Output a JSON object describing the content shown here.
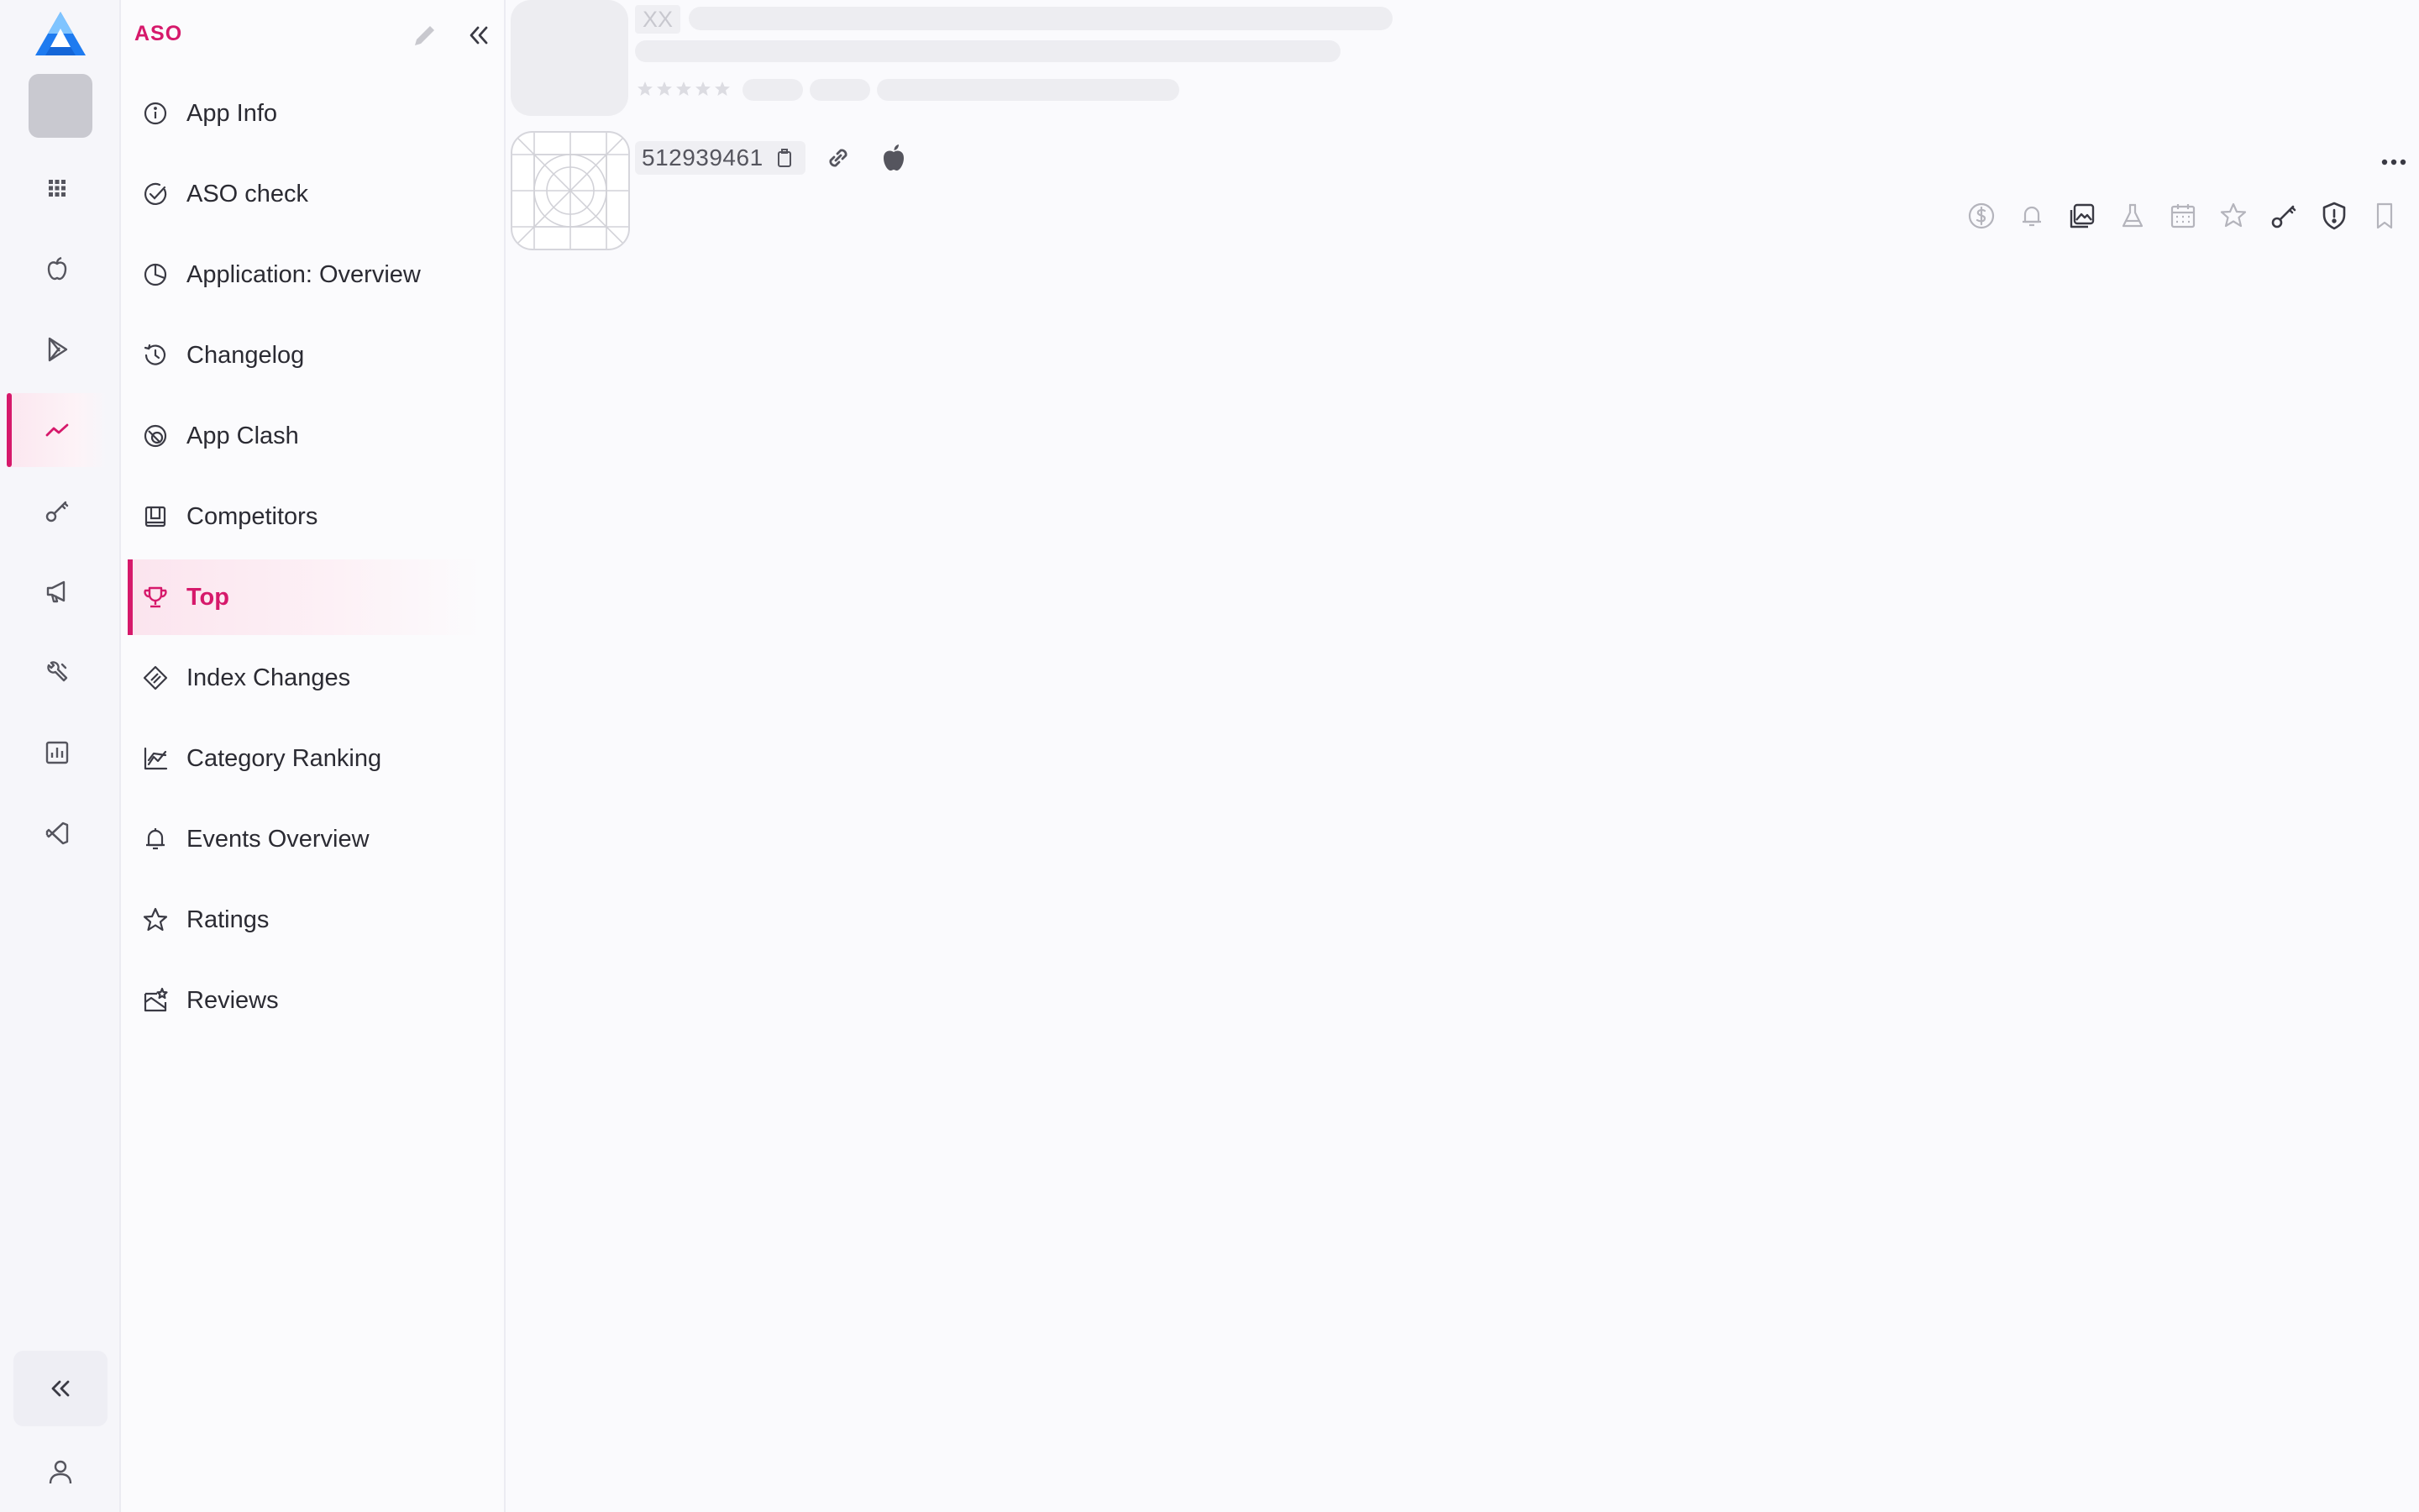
{
  "sidebar": {
    "section_title": "ASO",
    "items": [
      {
        "label": "App Info",
        "icon": "info-icon"
      },
      {
        "label": "ASO check",
        "icon": "check-circle-icon"
      },
      {
        "label": "Application: Overview",
        "icon": "pie-chart-icon"
      },
      {
        "label": "Changelog",
        "icon": "history-icon"
      },
      {
        "label": "App Clash",
        "icon": "overlap-circles-icon"
      },
      {
        "label": "Competitors",
        "icon": "competitors-icon"
      },
      {
        "label": "Top",
        "icon": "trophy-icon",
        "active": true
      },
      {
        "label": "Index Changes",
        "icon": "index-changes-icon"
      },
      {
        "label": "Category Ranking",
        "icon": "line-chart-icon"
      },
      {
        "label": "Events Overview",
        "icon": "bell-icon"
      },
      {
        "label": "Ratings",
        "icon": "star-icon"
      },
      {
        "label": "Reviews",
        "icon": "reviews-icon"
      }
    ]
  },
  "rail": {
    "items": [
      "apps-grid-icon",
      "apple-icon",
      "google-play-icon",
      "trend-icon",
      "key-icon",
      "megaphone-icon",
      "tools-icon",
      "bar-chart-icon",
      "vscode-icon"
    ],
    "active": "trend-icon"
  },
  "app": {
    "placeholder_badge": "XX",
    "app_id": "512939461",
    "platform_icon": "apple-icon"
  },
  "toolbar": [
    "dollar-icon",
    "bell-icon",
    "screenshots-icon",
    "flask-icon",
    "calendar-icon",
    "star-icon",
    "key-icon",
    "shield-icon",
    "bookmark-icon"
  ],
  "colors": {
    "accent": "#d6196b",
    "logo_blue": "#1e7bf0",
    "text": "#2b2b33",
    "muted": "#9b9ba6"
  }
}
